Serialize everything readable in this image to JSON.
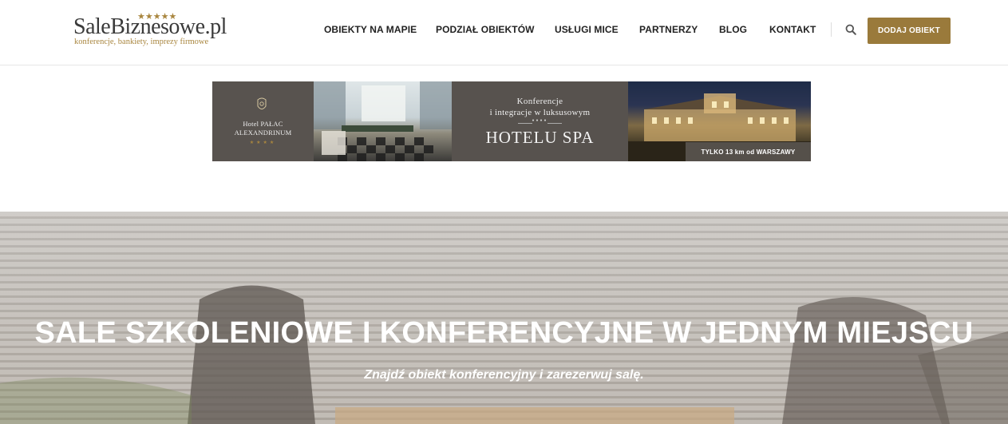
{
  "logo": {
    "name_part1": "SaleBiznesowe",
    "name_part2": ".pl",
    "stars": "★★★★★",
    "tagline": "konferencje, bankiety, imprezy firmowe"
  },
  "nav": {
    "items": [
      {
        "label": "OBIEKTY NA MAPIE"
      },
      {
        "label": "PODZIAŁ OBIEKTÓW"
      },
      {
        "label": "USŁUGI MICE"
      },
      {
        "label": "PARTNERZY"
      },
      {
        "label": "BLOG"
      },
      {
        "label": "KONTAKT"
      }
    ],
    "search_icon": "search-icon",
    "add_button": "DODAJ OBIEKT"
  },
  "banner": {
    "hotel_line1": "Hotel PAŁAC",
    "hotel_line2": "ALEXANDRINUM",
    "hotel_stars": "★★★★",
    "mid_line1": "Konferencje",
    "mid_line2": "i integracje w luksusowym",
    "mid_stars": "●●●●",
    "mid_line3": "HOTELU SPA",
    "tag": "TYLKO 13 km od WARSZAWY"
  },
  "hero": {
    "title": "SALE SZKOLENIOWE I KONFERENCYJNE W JEDNYM MIEJSCU",
    "subtitle": "Znajdź obiekt konferencyjny i zarezerwuj salę."
  },
  "colors": {
    "accent": "#9a7a3b",
    "nav_text": "#222222",
    "banner_bg": "#57524e"
  }
}
